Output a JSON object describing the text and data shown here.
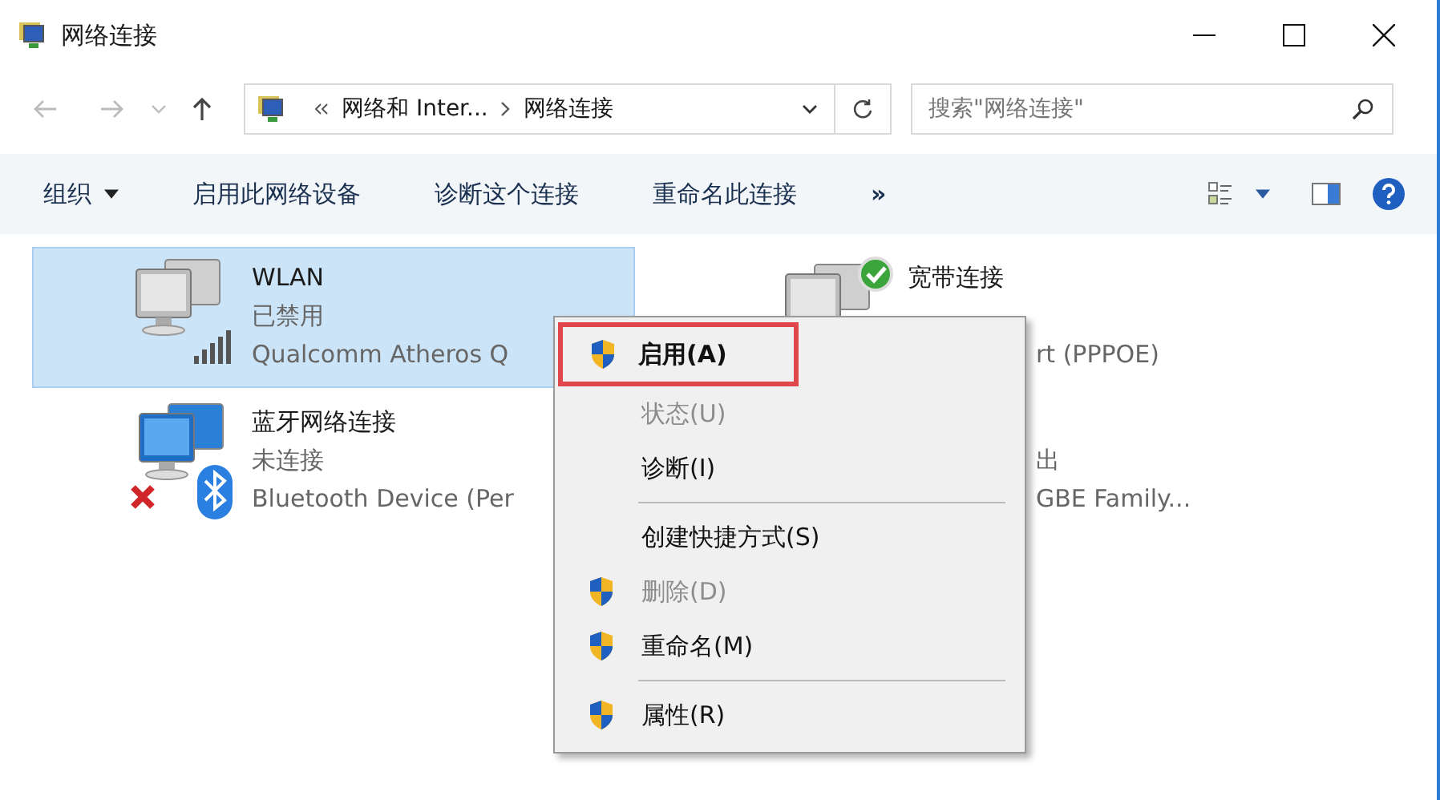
{
  "window": {
    "title": "网络连接"
  },
  "address": {
    "parent": "网络和 Inter...",
    "current": "网络连接"
  },
  "search": {
    "placeholder": "搜索\"网络连接\""
  },
  "toolbar": [
    {
      "label": "组织",
      "kind": "dropdown"
    },
    {
      "label": "启用此网络设备",
      "kind": "button"
    },
    {
      "label": "诊断这个连接",
      "kind": "button"
    },
    {
      "label": "重命名此连接",
      "kind": "button"
    },
    {
      "label": "»",
      "kind": "more"
    }
  ],
  "connections": [
    {
      "name": "WLAN",
      "status": "已禁用",
      "device": "Qualcomm Atheros Q",
      "kind": "wifi",
      "selected": true
    },
    {
      "name": "宽带连接",
      "device": "rt (PPPOE)",
      "device_covered": true,
      "kind": "broadband",
      "selected": false
    },
    {
      "name": "蓝牙网络连接",
      "status": "未连接",
      "device": "Bluetooth Device (Per",
      "kind": "bluetooth",
      "selected": false
    },
    {
      "status": "出",
      "device": "GBE Family...",
      "status_covered": true,
      "device_covered": true,
      "selected": false
    }
  ],
  "context_menu": [
    {
      "kind": "item",
      "label": "启用(A)",
      "shield": true,
      "disabled": false,
      "bold": true,
      "highlighted": true
    },
    {
      "kind": "item",
      "label": "状态(U)",
      "shield": false,
      "disabled": true,
      "bold": false,
      "highlighted": false
    },
    {
      "kind": "item",
      "label": "诊断(I)",
      "shield": false,
      "disabled": false,
      "bold": false,
      "highlighted": false
    },
    {
      "kind": "separator"
    },
    {
      "kind": "item",
      "label": "创建快捷方式(S)",
      "shield": false,
      "disabled": false,
      "bold": false,
      "highlighted": false
    },
    {
      "kind": "item",
      "label": "删除(D)",
      "shield": true,
      "disabled": true,
      "bold": false,
      "highlighted": false
    },
    {
      "kind": "item",
      "label": "重命名(M)",
      "shield": true,
      "disabled": false,
      "bold": false,
      "highlighted": false
    },
    {
      "kind": "separator"
    },
    {
      "kind": "item",
      "label": "属性(R)",
      "shield": true,
      "disabled": false,
      "bold": false,
      "highlighted": false
    }
  ]
}
